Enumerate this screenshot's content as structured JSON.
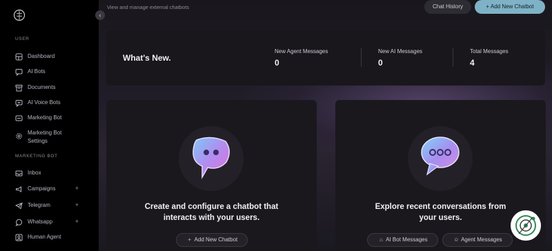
{
  "sidebar": {
    "sections": [
      {
        "label": "USER",
        "items": [
          {
            "label": "Dashboard",
            "icon": "dashboard-icon"
          },
          {
            "label": "AI Bots",
            "icon": "chat-icon"
          },
          {
            "label": "Documents",
            "icon": "document-icon"
          },
          {
            "label": "AI Voice Bots",
            "icon": "voice-icon"
          },
          {
            "label": "Marketing Bot",
            "icon": "megaphone-icon"
          },
          {
            "label": "Marketing Bot Settings",
            "icon": "gear-icon"
          }
        ]
      },
      {
        "label": "MARKETING BOT",
        "items": [
          {
            "label": "Inbox",
            "icon": "inbox-icon"
          },
          {
            "label": "Campaigns",
            "icon": "campaign-icon"
          },
          {
            "label": "Telegram",
            "icon": "telegram-icon"
          },
          {
            "label": "Whatsapp",
            "icon": "whatsapp-icon"
          },
          {
            "label": "Human Agent",
            "icon": "user-icon"
          }
        ]
      }
    ]
  },
  "header": {
    "subtitle": "View and manage external chatbots",
    "history_label": "Chat History",
    "add_label": "+ Add New Chatbot"
  },
  "stats": {
    "title": "What's New.",
    "items": [
      {
        "label": "New Agent Messages",
        "value": "0"
      },
      {
        "label": "New AI Messages",
        "value": "0"
      },
      {
        "label": "Total Messages",
        "value": "4"
      }
    ]
  },
  "cards": [
    {
      "headline_line1": "Create and configure a chatbot that",
      "headline_line2": "interacts with your users.",
      "buttons": [
        {
          "label": "Add New Chatbot",
          "icon": "plus-icon"
        }
      ]
    },
    {
      "headline_line1": "Explore recent conversations from",
      "headline_line2": "your users.",
      "buttons": [
        {
          "label": "AI Bot Messages",
          "icon": "bot-icon"
        },
        {
          "label": "Agent Messages",
          "icon": "person-icon"
        }
      ]
    }
  ],
  "colors": {
    "accent": "#7fb2c6",
    "sidebar_bg": "#000000",
    "card_bg": "#1a181d"
  }
}
